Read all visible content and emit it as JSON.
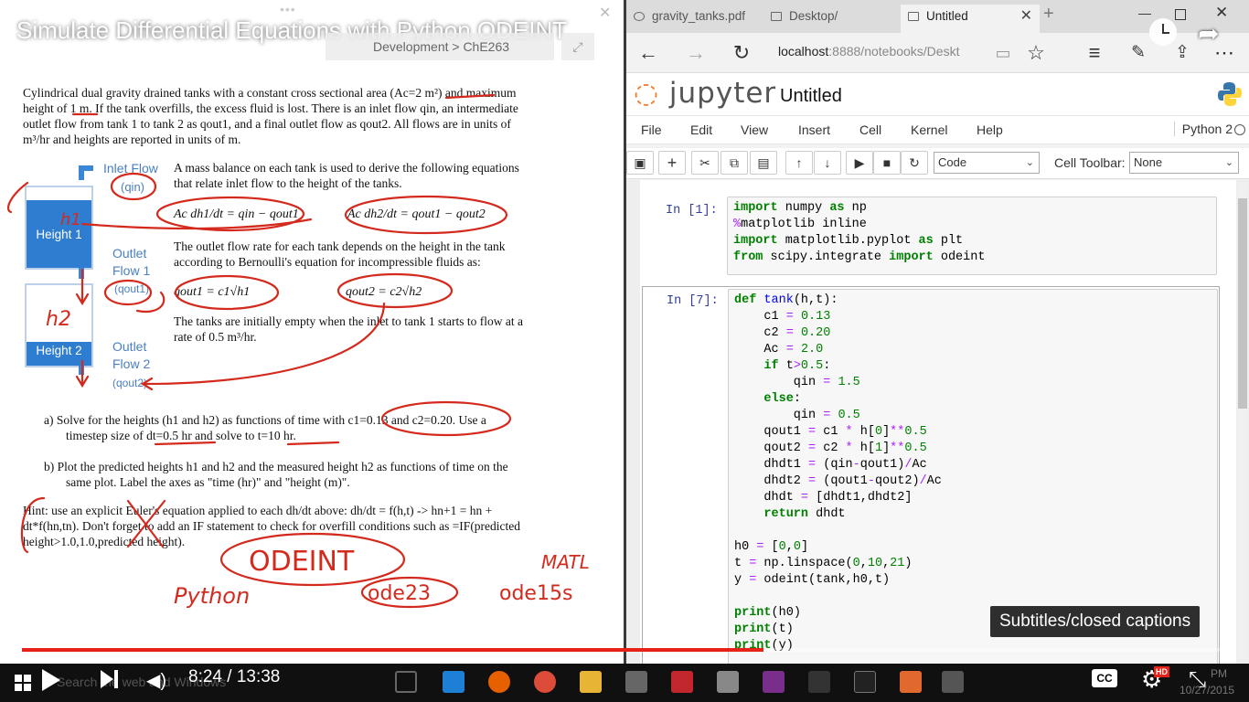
{
  "video": {
    "title": "Simulate Differential Equations with Python ODEINT",
    "breadcrumb": "Development > ChE263",
    "time": "8:24 / 13:38",
    "progress": 0.6152,
    "subtitles_tooltip": "Subtitles/closed captions",
    "cc_label": "CC",
    "hd_label": "HD",
    "taskbar_search": "Search the web and Windows",
    "clock_time": "PM",
    "clock_date": "10/27/2015",
    "accent": "#e62117"
  },
  "doc": {
    "intro_lines": [
      "Cylindrical dual gravity drained tanks with a constant cross sectional area (Ac=2 m²) and maximum",
      "height of 1 m. If the tank overfills, the excess fluid is lost. There is an inlet flow qin, an intermediate",
      "outlet flow from tank 1 to tank 2 as qout1, and a final outlet flow as qout2. All flows are in units of",
      "m³/hr and heights are reported in units of m."
    ],
    "inlet_label_1": "Inlet Flow",
    "inlet_label_2": "(qin)",
    "tank1_label": "Height 1",
    "tank2_label": "Height 2",
    "outlet1_label_1": "Outlet",
    "outlet1_label_2": "Flow 1",
    "outlet1_label_3": "(qout1)",
    "outlet2_label_1": "Outlet",
    "outlet2_label_2": "Flow 2",
    "outlet2_label_3": "(qout2)",
    "mass_balance_1": "A mass balance on each tank is used to derive the following equations",
    "mass_balance_2": "that relate inlet flow to the height of the tanks.",
    "eq1": "Ac dh1/dt = qin − qout1",
    "eq2": "Ac dh2/dt = qout1 − qout2",
    "bernoulli_1": "The outlet flow rate for each tank depends on the height in the tank",
    "bernoulli_2": "according to Bernoulli's equation for incompressible fluids as:",
    "eq3": "qout1 = c1√h1",
    "eq4": "qout2 = c2√h2",
    "initial_1": "The tanks are initially empty when the inlet to tank 1 starts to flow at a",
    "initial_2": "rate of 0.5 m³/hr.",
    "item_a_1": "a)   Solve for the heights (h1 and h2) as functions of time with c1=0.13 and c2=0.20. Use a",
    "item_a_2": "timestep size of dt=0.5 hr and solve to t=10 hr.",
    "item_b_1": "b)   Plot the predicted heights h1 and h2 and the measured height h2 as functions of time on the",
    "item_b_2": "same plot.  Label the axes as \"time (hr)\" and \"height (m)\".",
    "hint_1": "Hint: use an explicit Euler's equation applied to each dh/dt above: dh/dt = f(h,t) -> hn+1 = hn +",
    "hint_2": "dt*f(hn,tn). Don't forget to add an IF statement to check for overfill conditions such as =IF(predicted",
    "hint_3": "height>1.0,1.0,predicted height).",
    "annotations": {
      "odeint": "ODEINT",
      "python": "Python",
      "matlab": "MATL",
      "ode23": "ode23",
      "ode15s": "ode15s",
      "h1": "h1",
      "h2": "h2"
    },
    "ink_color": "#d42a1e"
  },
  "browser": {
    "tabs": [
      {
        "label": "gravity_tanks.pdf"
      },
      {
        "label": "Desktop/"
      },
      {
        "label": "Untitled"
      }
    ],
    "url_host": "localhost",
    "url_rest": ":8888/notebooks/Deskt"
  },
  "jupyter": {
    "logo": "jupyter",
    "title": "Untitled",
    "menu": [
      "File",
      "Edit",
      "View",
      "Insert",
      "Cell",
      "Kernel",
      "Help"
    ],
    "kernel": "Python 2",
    "cell_type": "Code",
    "cell_toolbar_label": "Cell Toolbar:",
    "cell_toolbar_value": "None",
    "cells": [
      {
        "prompt": "In [1]:"
      },
      {
        "prompt": "In [7]:"
      }
    ]
  }
}
